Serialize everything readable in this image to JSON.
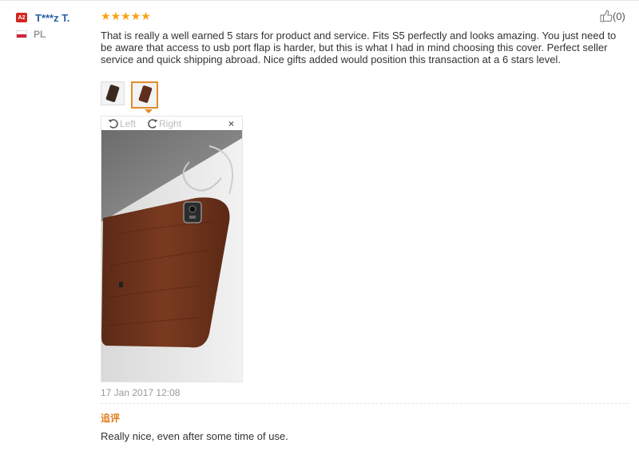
{
  "reviewer": {
    "badge": "A2",
    "name": "T***z T.",
    "country": "PL"
  },
  "rating": {
    "stars": 5,
    "max": 5,
    "star_glyph": "★"
  },
  "helpful": {
    "count": "(0)",
    "icon": "thumbs-up-icon"
  },
  "review": {
    "text": "That is really a well earned 5 stars for product and service. Fits S5 perfectly and looks amazing. You just need to be aware that access to usb port flap is harder, but this is what I had in mind choosing this cover. Perfect seller service and quick shipping abroad. Nice gifts added would position this transaction at a 6 stars level.",
    "date": "17 Jan 2017 12:08"
  },
  "viewer": {
    "rotate_left_label": "Left",
    "rotate_right_label": "Right",
    "close_label": "×"
  },
  "followup": {
    "label": "追评",
    "text": "Really nice, even after some time of use."
  },
  "colors": {
    "accent_orange": "#e27b1d",
    "star": "#f8a116",
    "name_blue": "#2a5ea8",
    "badge_red": "#d4251f"
  }
}
